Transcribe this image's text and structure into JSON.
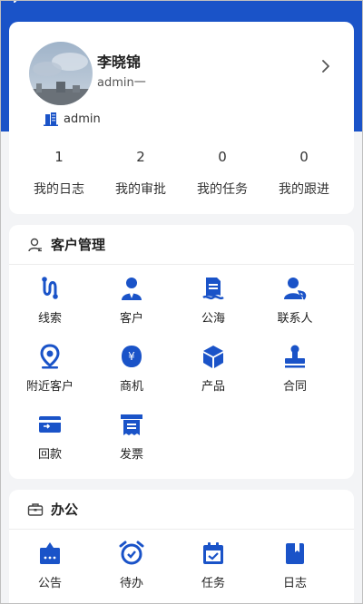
{
  "profile": {
    "name": "李晓锦",
    "role": "admin一",
    "org": "admin"
  },
  "stats": [
    {
      "value": "1",
      "label": "我的日志"
    },
    {
      "value": "2",
      "label": "我的审批"
    },
    {
      "value": "0",
      "label": "我的任务"
    },
    {
      "value": "0",
      "label": "我的跟进"
    }
  ],
  "customer_section": {
    "title": "客户管理",
    "items": [
      {
        "label": "线索",
        "icon": "clue-icon"
      },
      {
        "label": "客户",
        "icon": "customer-icon"
      },
      {
        "label": "公海",
        "icon": "public-pool-icon"
      },
      {
        "label": "联系人",
        "icon": "contact-icon"
      },
      {
        "label": "附近客户",
        "icon": "location-pin-icon"
      },
      {
        "label": "商机",
        "icon": "opportunity-icon"
      },
      {
        "label": "产品",
        "icon": "product-box-icon"
      },
      {
        "label": "合同",
        "icon": "contract-stamp-icon"
      },
      {
        "label": "回款",
        "icon": "payment-card-icon"
      },
      {
        "label": "发票",
        "icon": "invoice-icon"
      }
    ]
  },
  "office_section": {
    "title": "办公",
    "items": [
      {
        "label": "公告",
        "icon": "announcement-icon"
      },
      {
        "label": "待办",
        "icon": "alarm-clock-icon"
      },
      {
        "label": "任务",
        "icon": "calendar-task-icon"
      },
      {
        "label": "日志",
        "icon": "log-book-icon"
      }
    ]
  },
  "colors": {
    "brand": "#1a53c8",
    "background": "#f3f4f6",
    "card": "#ffffff"
  }
}
